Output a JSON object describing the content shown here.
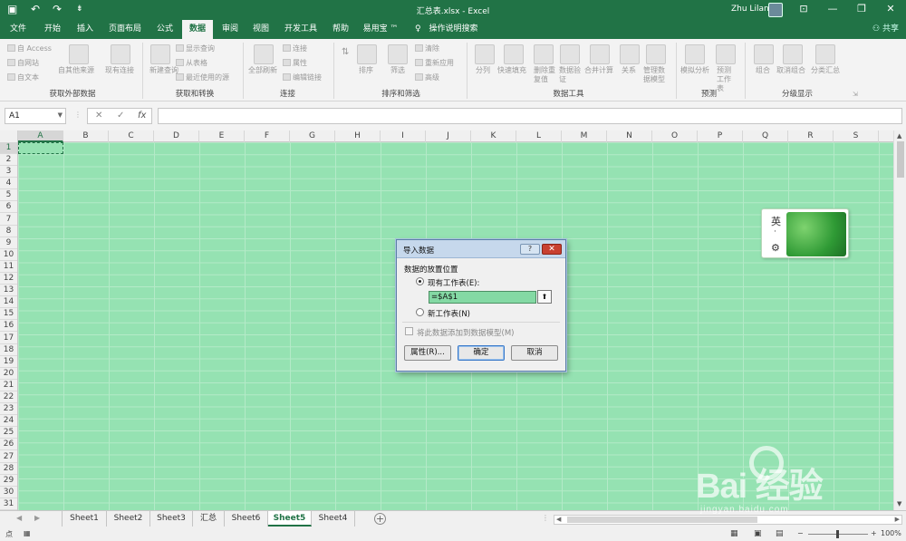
{
  "window": {
    "title": "汇总表.xlsx  -  Excel",
    "user": "Zhu Lilan",
    "qat_undo": "↶",
    "qat_redo": "↷",
    "qat_more": "⇟",
    "ribbon_toggle": "⊡",
    "minimize": "—",
    "restore": "❐",
    "close": "✕"
  },
  "menu": {
    "tabs": [
      "文件",
      "开始",
      "插入",
      "页面布局",
      "公式",
      "数据",
      "审阅",
      "视图",
      "开发工具",
      "帮助",
      "易用宝 ™"
    ],
    "active_tab": "数据",
    "tell_me": "操作说明搜索",
    "share": "共享"
  },
  "ribbon": {
    "groups": [
      "获取外部数据",
      "获取和转换",
      "连接",
      "排序和筛选",
      "数据工具",
      "预测",
      "分级显示"
    ],
    "external": [
      "自 Access",
      "自网站",
      "自文本",
      "自其他来源",
      "现有连接"
    ],
    "transform": [
      "新建查询",
      "显示查询",
      "从表格",
      "最近使用的源"
    ],
    "transform_big": "全部刷新",
    "connections": [
      "连接",
      "属性",
      "编辑链接"
    ],
    "sort": [
      "排序",
      "筛选",
      "清除",
      "重新应用",
      "高级"
    ],
    "tools": [
      "分列",
      "快速填充",
      "删除重复值",
      "数据验证",
      "合并计算",
      "关系",
      "管理数据模型"
    ],
    "forecast": [
      "模拟分析",
      "预测工作表"
    ],
    "outline": [
      "组合",
      "取消组合",
      "分类汇总"
    ]
  },
  "formula_bar": {
    "name_box": "A1",
    "cancel": "✕",
    "enter": "✓",
    "fx": "fx",
    "content": ""
  },
  "grid": {
    "columns": [
      "A",
      "B",
      "C",
      "D",
      "E",
      "F",
      "G",
      "H",
      "I",
      "J",
      "K",
      "L",
      "M",
      "N",
      "O",
      "P",
      "Q",
      "R",
      "S"
    ],
    "rows": [
      "1",
      "2",
      "3",
      "4",
      "5",
      "6",
      "7",
      "8",
      "9",
      "10",
      "11",
      "12",
      "13",
      "14",
      "15",
      "16",
      "17",
      "18",
      "19",
      "20",
      "21",
      "22",
      "23",
      "24",
      "25",
      "26",
      "27",
      "28",
      "29",
      "30",
      "31"
    ],
    "selected_cell": "A1",
    "color": "#95e2b2"
  },
  "sheets": {
    "tabs": [
      "Sheet1",
      "Sheet2",
      "Sheet3",
      "汇总",
      "Sheet6",
      "Sheet5",
      "Sheet4"
    ],
    "active": "Sheet5",
    "add": "+",
    "prev": "◀",
    "next": "▶"
  },
  "status": {
    "ready": "点",
    "zoom": "100%"
  },
  "dialog": {
    "title": "导入数据",
    "help": "?",
    "close": "✕",
    "section": "数据的放置位置",
    "existing_sheet": "现有工作表(E):",
    "reference": "=$A$1",
    "collapse": "⬆",
    "new_sheet": "新工作表(N)",
    "add_model": "将此数据添加到数据模型(M)",
    "properties": "属性(R)...",
    "ok": "确定",
    "cancel": "取消"
  },
  "ime": {
    "lang": "英",
    "dot": "·",
    "gear": "⚙"
  },
  "watermark": {
    "brand": "Bai 经验",
    "url": "jingyan.baidu.com"
  },
  "colors": {
    "accent": "#217346",
    "grid_fill": "#95e2b2",
    "dialog_title": "#c6d8ec"
  }
}
